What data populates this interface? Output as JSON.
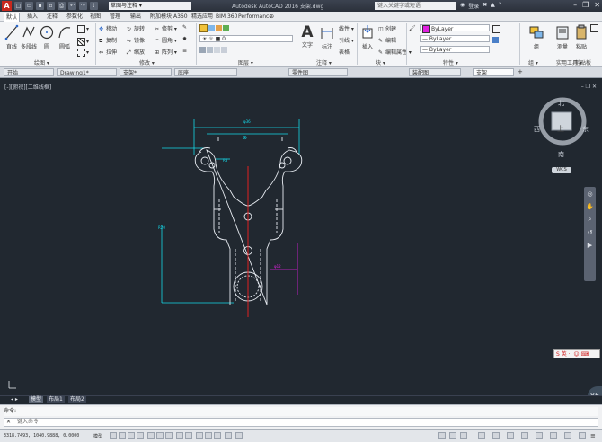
{
  "app": {
    "logo_letter": "A",
    "workspace": "草图与注释",
    "title": "Autodesk AutoCAD 2016    支架.dwg",
    "search_placeholder": "键入关键字或短语",
    "user": "登录",
    "window_buttons": [
      "–",
      "❐",
      "✕"
    ]
  },
  "ribbon_tabs": [
    "默认",
    "插入",
    "注释",
    "参数化",
    "视图",
    "管理",
    "输出",
    "附加模块",
    "A360",
    "精选应用",
    "BIM 360",
    "Performance"
  ],
  "ribbon": {
    "draw": {
      "label": "绘图",
      "line": "直线",
      "polyline": "多段线",
      "circle": "圆",
      "arc": "圆弧"
    },
    "modify": {
      "label": "修改",
      "items": [
        "移动",
        "旋转",
        "修剪",
        "复制",
        "镜像",
        "圆角",
        "拉伸",
        "缩放",
        "阵列"
      ]
    },
    "annotation": {
      "label": "注释",
      "text": "文字",
      "dimension": "标注",
      "linear": "线性",
      "leader": "引线",
      "table": "表格"
    },
    "layers": {
      "label": "图层",
      "current_layer": "0",
      "properties": "图层特性"
    },
    "block": {
      "label": "块",
      "insert": "插入",
      "create": "创建",
      "edit": "编辑",
      "edit_attr": "编辑属性"
    },
    "properties": {
      "label": "特性",
      "color": "ByLayer",
      "linetype": "ByLayer",
      "lineweight": "ByLayer",
      "match": "特性匹配"
    },
    "groups": {
      "label": "组",
      "group": "组"
    },
    "utilities": {
      "label": "实用工具",
      "measure": "测量"
    },
    "clipboard": {
      "label": "剪贴板",
      "paste": "粘贴"
    },
    "view": {
      "label": "视图",
      "base": "基点"
    }
  },
  "doc_tabs": [
    {
      "label": "开始",
      "active": false
    },
    {
      "label": "Drawing1*",
      "active": false
    },
    {
      "label": "支架*",
      "active": false
    },
    {
      "label": "底座",
      "active": false
    },
    {
      "label": "零件图",
      "active": false
    },
    {
      "label": "装配图",
      "active": false
    },
    {
      "label": "支架",
      "active": true
    }
  ],
  "viewport": {
    "label": "[-][俯视][二维线框]",
    "controls": "– ❐ ✕",
    "dims": {
      "top_width": "φ36",
      "left_note": "R8",
      "center_note": "φ10",
      "right_note": "φ12",
      "side_left": "R20"
    }
  },
  "viewcube": {
    "north": "北",
    "south": "南",
    "east": "东",
    "west": "西",
    "face": "上",
    "wcs": "WCS"
  },
  "ime": "S 英 ·, ☺ ⌨",
  "speed": "86",
  "layout_tabs": [
    "模型",
    "布局1",
    "布局2"
  ],
  "command": {
    "history": "命令:",
    "placeholder": "键入命令"
  },
  "status": {
    "coords": "3318.7493, 1040.9888, 0.0000",
    "mode": "模型"
  },
  "colors": {
    "cyan": "#15d8e8",
    "red": "#e02020",
    "magenta": "#e020e0",
    "white": "#e8ecf2",
    "viewport_bg": "#212830"
  }
}
